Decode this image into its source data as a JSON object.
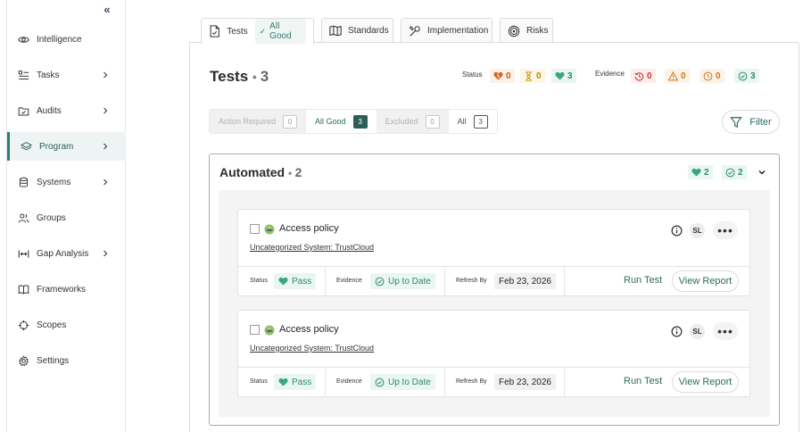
{
  "sidebar": {
    "items": [
      {
        "label": "Intelligence",
        "icon": "eye-icon",
        "has_chevron": false
      },
      {
        "label": "Tasks",
        "icon": "tasks-icon",
        "has_chevron": true
      },
      {
        "label": "Audits",
        "icon": "folder-check-icon",
        "has_chevron": true
      },
      {
        "label": "Program",
        "icon": "layers-icon",
        "has_chevron": true,
        "active": true
      },
      {
        "label": "Systems",
        "icon": "database-icon",
        "has_chevron": true
      },
      {
        "label": "Groups",
        "icon": "users-icon",
        "has_chevron": false
      },
      {
        "label": "Gap Analysis",
        "icon": "gap-analysis-icon",
        "has_chevron": true
      },
      {
        "label": "Frameworks",
        "icon": "book-icon",
        "has_chevron": false
      },
      {
        "label": "Scopes",
        "icon": "crosshair-icon",
        "has_chevron": false
      },
      {
        "label": "Settings",
        "icon": "gear-icon",
        "has_chevron": false
      }
    ]
  },
  "tabs": {
    "tests": {
      "label": "Tests",
      "status": "All Good"
    },
    "standards": {
      "label": "Standards"
    },
    "implementation": {
      "label": "Implementation"
    },
    "risks": {
      "label": "Risks"
    }
  },
  "header": {
    "title": "Tests",
    "count": "3"
  },
  "summary": {
    "status_label": "Status",
    "status_chips": [
      {
        "kind": "failing",
        "icon": "broken-heart-icon",
        "value": "0",
        "color": "#c65a1e"
      },
      {
        "kind": "pending",
        "icon": "hourglass-icon",
        "value": "0",
        "color": "#b7851a"
      },
      {
        "kind": "passing",
        "icon": "heart-icon",
        "value": "3",
        "color": "#2f8a6b"
      }
    ],
    "evidence_label": "Evidence",
    "evidence_chips": [
      {
        "kind": "overdue",
        "icon": "history-icon",
        "value": "0",
        "color": "#c43b3b"
      },
      {
        "kind": "warning",
        "icon": "warning-icon",
        "value": "0",
        "color": "#c97a23"
      },
      {
        "kind": "due-soon",
        "icon": "clock-icon",
        "value": "0",
        "color": "#c97a23"
      },
      {
        "kind": "current",
        "icon": "check-circle-icon",
        "value": "3",
        "color": "#2f8a6b"
      }
    ]
  },
  "filters": [
    {
      "label": "Action Required",
      "count": "0"
    },
    {
      "label": "All Good",
      "count": "3"
    },
    {
      "label": "Excluded",
      "count": "0"
    },
    {
      "label": "All",
      "count": "3"
    }
  ],
  "filter_button": {
    "label": "Filter"
  },
  "automated": {
    "title": "Automated",
    "count": "2",
    "passing": "2",
    "current": "2"
  },
  "cards": [
    {
      "title": "Access policy",
      "system": "Uncategorized System: TrustCloud",
      "avatar": "SL",
      "status_label": "Status",
      "status_value": "Pass",
      "evidence_label": "Evidence",
      "evidence_value": "Up to Date",
      "refresh_label": "Refresh By",
      "refresh_value": "Feb 23, 2026",
      "run_label": "Run Test",
      "report_label": "View Report"
    },
    {
      "title": "Access policy",
      "system": "Uncategorized System: TrustCloud",
      "avatar": "SL",
      "status_label": "Status",
      "status_value": "Pass",
      "evidence_label": "Evidence",
      "evidence_value": "Up to Date",
      "refresh_label": "Refresh By",
      "refresh_value": "Feb 23, 2026",
      "run_label": "Run Test",
      "report_label": "View Report"
    }
  ],
  "colors": {
    "accent": "#2f7d74",
    "pass": "#2f8a6b"
  }
}
